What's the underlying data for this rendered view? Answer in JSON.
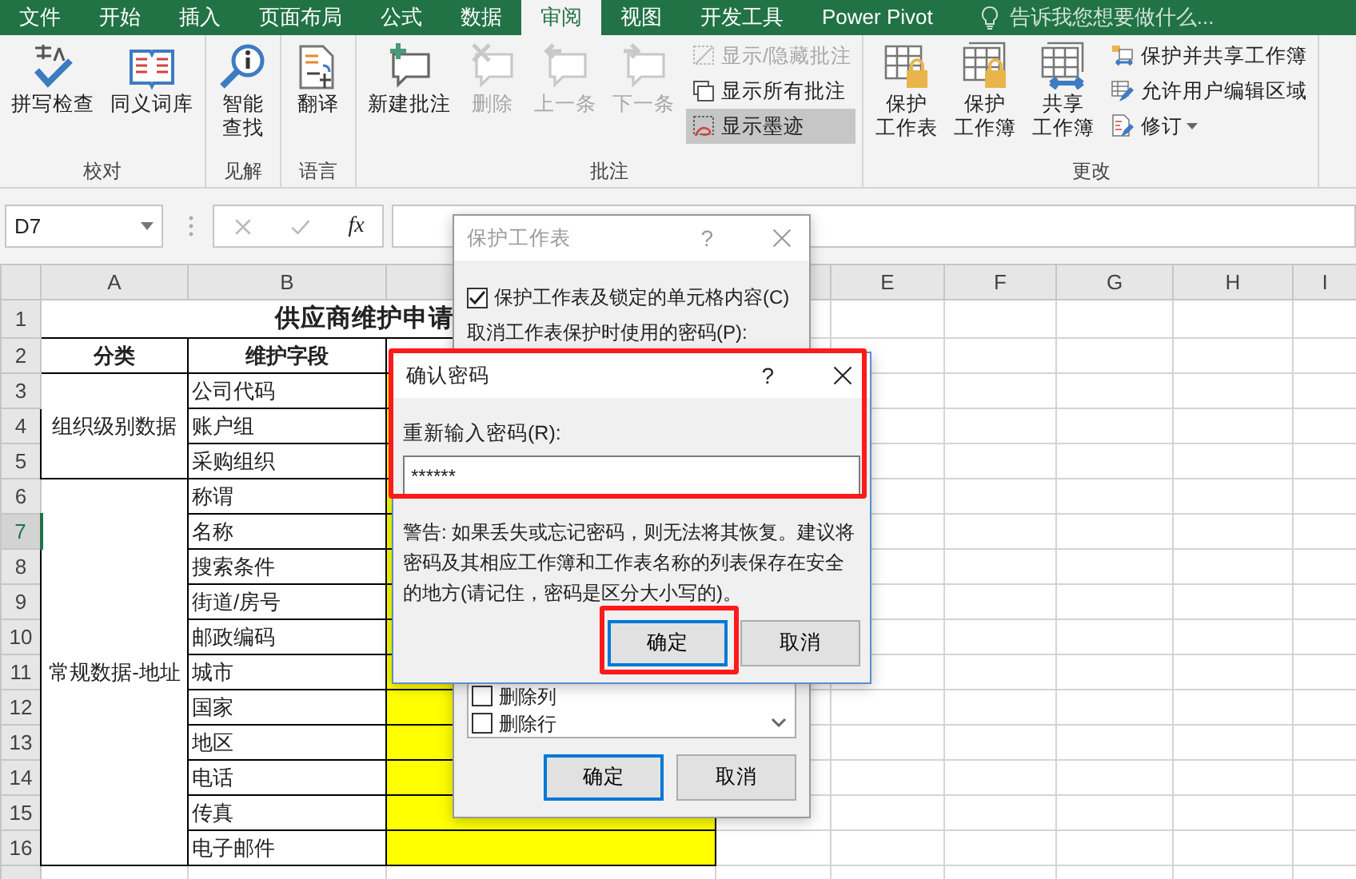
{
  "tabs": [
    {
      "label": "文件",
      "selected": false
    },
    {
      "label": "开始",
      "selected": false
    },
    {
      "label": "插入",
      "selected": false
    },
    {
      "label": "页面布局",
      "selected": false
    },
    {
      "label": "公式",
      "selected": false
    },
    {
      "label": "数据",
      "selected": false
    },
    {
      "label": "审阅",
      "selected": true
    },
    {
      "label": "视图",
      "selected": false
    },
    {
      "label": "开发工具",
      "selected": false
    },
    {
      "label": "Power Pivot",
      "selected": false
    }
  ],
  "tell_me": {
    "placeholder": "告诉我您想要做什么..."
  },
  "ribbon_groups": [
    {
      "label": "校对",
      "items": [
        {
          "kind": "large",
          "lines": [
            "拼写检查"
          ],
          "disabled": false,
          "pressed": false,
          "dropdown": false
        },
        {
          "kind": "large",
          "lines": [
            "同义词库"
          ],
          "disabled": false,
          "pressed": false,
          "dropdown": false
        }
      ]
    },
    {
      "label": "见解",
      "items": [
        {
          "kind": "large",
          "lines": [
            "智能",
            "查找"
          ],
          "disabled": false,
          "pressed": false,
          "dropdown": false
        }
      ]
    },
    {
      "label": "语言",
      "items": [
        {
          "kind": "large",
          "lines": [
            "翻译"
          ],
          "disabled": false,
          "pressed": false,
          "dropdown": false
        }
      ]
    },
    {
      "label": "批注",
      "items": [
        {
          "kind": "large",
          "lines": [
            "新建批注"
          ],
          "disabled": false,
          "pressed": false,
          "dropdown": false
        },
        {
          "kind": "large",
          "lines": [
            "删除"
          ],
          "disabled": true,
          "pressed": false,
          "dropdown": false
        },
        {
          "kind": "large",
          "lines": [
            "上一条"
          ],
          "disabled": true,
          "pressed": false,
          "dropdown": false
        },
        {
          "kind": "large",
          "lines": [
            "下一条"
          ],
          "disabled": true,
          "pressed": false,
          "dropdown": false
        },
        {
          "kind": "small",
          "lines": [
            "显示/隐藏批注"
          ],
          "disabled": true,
          "pressed": false,
          "dropdown": false
        },
        {
          "kind": "small",
          "lines": [
            "显示所有批注"
          ],
          "disabled": false,
          "pressed": false,
          "dropdown": false
        },
        {
          "kind": "small",
          "lines": [
            "显示墨迹"
          ],
          "disabled": false,
          "pressed": true,
          "dropdown": false
        }
      ]
    },
    {
      "label": "更改",
      "items": [
        {
          "kind": "large",
          "lines": [
            "保护",
            "工作表"
          ],
          "disabled": false,
          "pressed": false,
          "dropdown": false
        },
        {
          "kind": "large",
          "lines": [
            "保护",
            "工作簿"
          ],
          "disabled": false,
          "pressed": false,
          "dropdown": false
        },
        {
          "kind": "large",
          "lines": [
            "共享",
            "工作簿"
          ],
          "disabled": false,
          "pressed": false,
          "dropdown": false
        },
        {
          "kind": "small",
          "lines": [
            "保护并共享工作簿"
          ],
          "disabled": false,
          "pressed": false,
          "dropdown": false
        },
        {
          "kind": "small",
          "lines": [
            "允许用户编辑区域"
          ],
          "disabled": false,
          "pressed": false,
          "dropdown": false
        },
        {
          "kind": "small",
          "lines": [
            "修订"
          ],
          "disabled": false,
          "pressed": false,
          "dropdown": true
        }
      ]
    }
  ],
  "formula_bar": {
    "name_box": "D7",
    "function_label": "fx"
  },
  "sheet": {
    "column_headers": [
      {
        "letter": "A"
      },
      {
        "letter": "B"
      },
      {
        "letter": "E"
      },
      {
        "letter": "F"
      },
      {
        "letter": "G"
      },
      {
        "letter": "H"
      },
      {
        "letter": "I"
      }
    ],
    "row_headers": [
      {
        "label": "1",
        "selected": false
      },
      {
        "label": "2",
        "selected": false
      },
      {
        "label": "3",
        "selected": false
      },
      {
        "label": "4",
        "selected": false
      },
      {
        "label": "5",
        "selected": false
      },
      {
        "label": "6",
        "selected": false
      },
      {
        "label": "7",
        "selected": true
      },
      {
        "label": "8",
        "selected": false
      },
      {
        "label": "9",
        "selected": false
      },
      {
        "label": "10",
        "selected": false
      },
      {
        "label": "11",
        "selected": false
      },
      {
        "label": "12",
        "selected": false
      },
      {
        "label": "13",
        "selected": false
      },
      {
        "label": "14",
        "selected": false
      },
      {
        "label": "15",
        "selected": false
      },
      {
        "label": "16",
        "selected": false
      }
    ],
    "title": "供应商维护申请",
    "header_row": [
      "分类",
      "维护字段"
    ],
    "groups": [
      {
        "category": "组织级别数据",
        "fields": [
          "公司代码",
          "账户组",
          "采购组织"
        ]
      },
      {
        "category": "常规数据-地址",
        "fields": [
          "称谓",
          "名称",
          "搜索条件",
          "街道/房号",
          "邮政编码",
          "城市",
          "国家",
          "地区",
          "电话",
          "传真",
          "电子邮件"
        ]
      }
    ]
  },
  "protect_dialog": {
    "title": "保护工作表",
    "help": "?",
    "protect_option": {
      "label": "保护工作表及锁定的单元格内容(C)",
      "checked": true
    },
    "password_label": "取消工作表保护时使用的密码(P):",
    "permissions": [
      {
        "label": "删除列",
        "checked": false
      },
      {
        "label": "删除行",
        "checked": false
      }
    ],
    "buttons": [
      {
        "label": "确定",
        "default": true
      },
      {
        "label": "取消",
        "default": false
      }
    ]
  },
  "confirm_dialog": {
    "title": "确认密码",
    "help": "?",
    "prompt": "重新输入密码(R):",
    "password": "******",
    "warning": "警告: 如果丢失或忘记密码，则无法将其恢复。建议将密码及其相应工作簿和工作表名称的列表保存在安全的地方(请记住，密码是区分大小写的)。",
    "buttons": [
      {
        "label": "确定",
        "default": true
      },
      {
        "label": "取消",
        "default": false
      }
    ]
  }
}
